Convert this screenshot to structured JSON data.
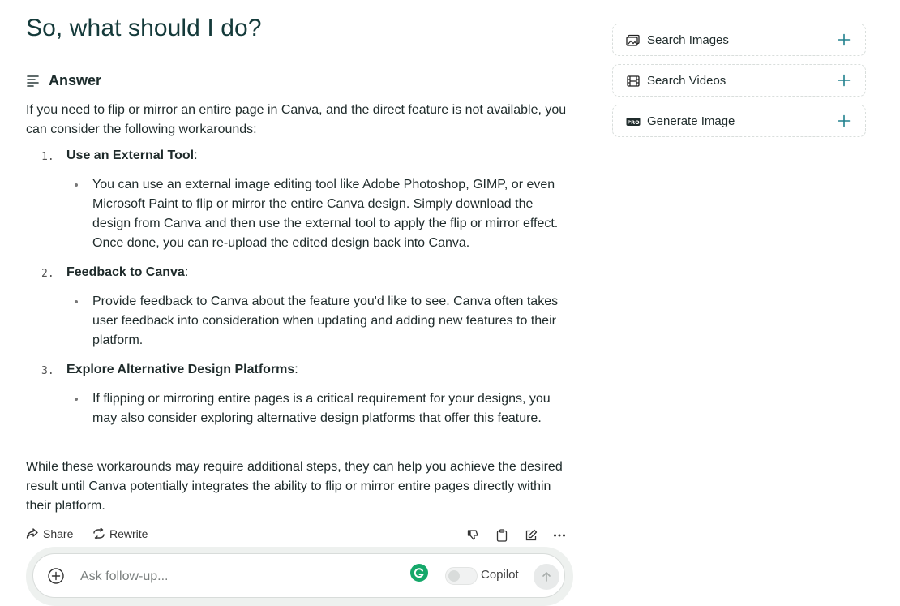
{
  "question": "So, what should I do?",
  "answer": {
    "label": "Answer",
    "intro": "If you need to flip or mirror an entire page in Canva, and the direct feature is not available, you can consider the following workarounds:",
    "items": [
      {
        "num": "1.",
        "title": "Use an External Tool",
        "suffix": ":",
        "bullet": "You can use an external image editing tool like Adobe Photoshop, GIMP, or even Microsoft Paint to flip or mirror the entire Canva design. Simply download the design from Canva and then use the external tool to apply the flip or mirror effect. Once done, you can re-upload the edited design back into Canva."
      },
      {
        "num": "2.",
        "title": "Feedback to Canva",
        "suffix": ":",
        "bullet": "Provide feedback to Canva about the feature you'd like to see. Canva often takes user feedback into consideration when updating and adding new features to their platform."
      },
      {
        "num": "3.",
        "title": "Explore Alternative Design Platforms",
        "suffix": ":",
        "bullet": "If flipping or mirroring entire pages is a critical requirement for your designs, you may also consider exploring alternative design platforms that offer this feature."
      }
    ],
    "outro": "While these workarounds may require additional steps, they can help you achieve the desired result until Canva potentially integrates the ability to flip or mirror entire pages directly within their platform."
  },
  "actions": {
    "share": "Share",
    "rewrite": "Rewrite"
  },
  "composer": {
    "placeholder": "Ask follow-up...",
    "copilot": "Copilot"
  },
  "sidebar": [
    {
      "label": "Search Images",
      "icon": "image-icon"
    },
    {
      "label": "Search Videos",
      "icon": "film-icon"
    },
    {
      "label": "Generate Image",
      "icon": "pro-badge-icon"
    }
  ],
  "colors": {
    "accent": "#20808d",
    "heading": "#143a3a",
    "grammarly": "#15a86a"
  }
}
